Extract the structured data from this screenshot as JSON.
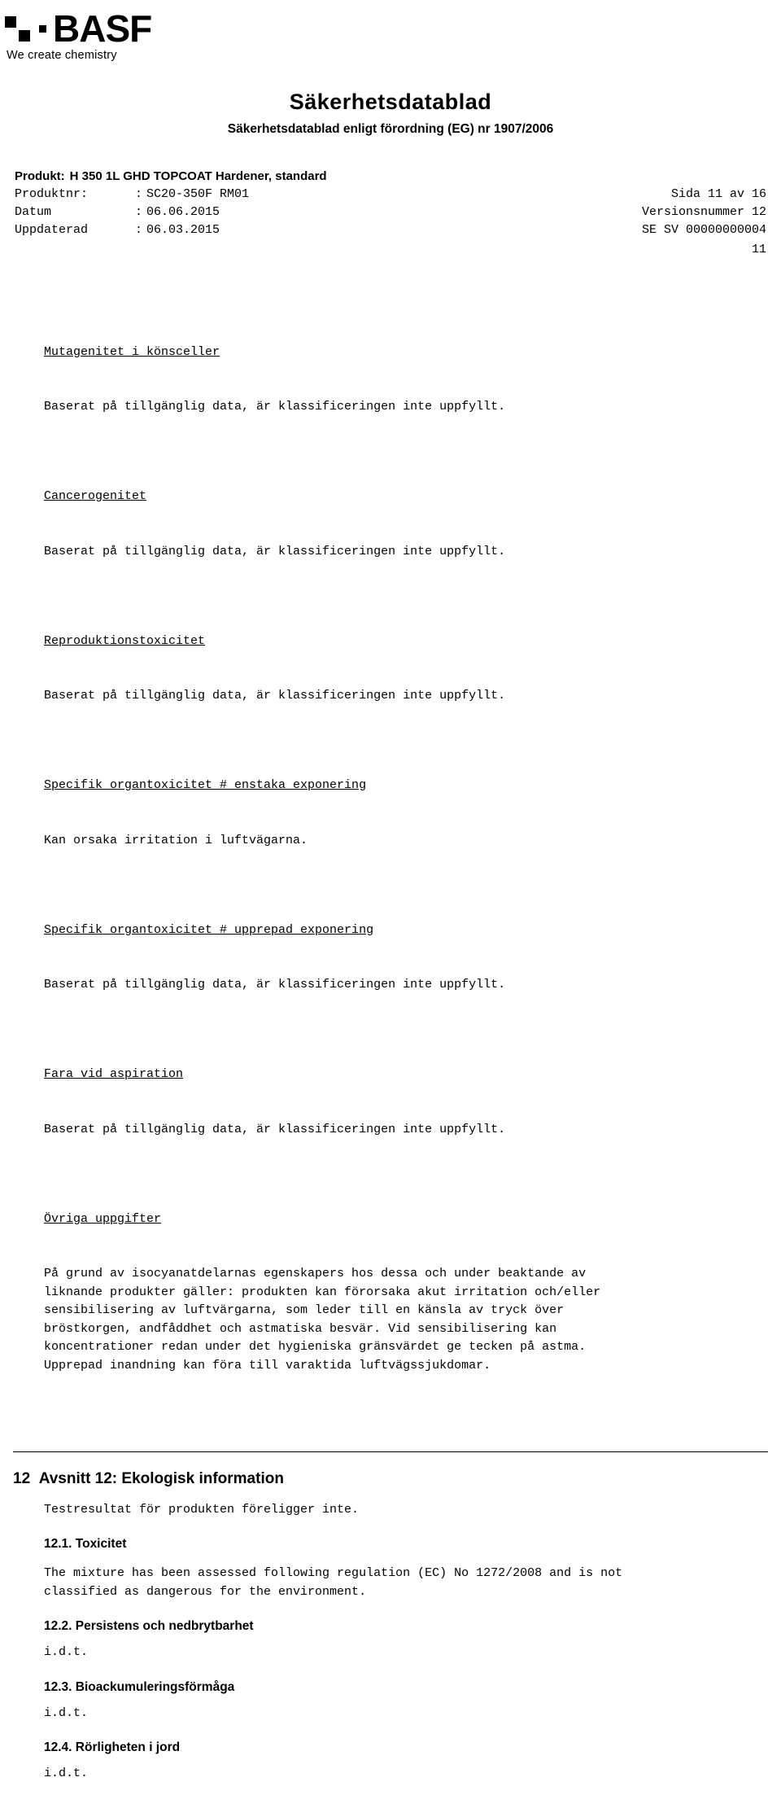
{
  "logo": {
    "brand": "BASF",
    "tagline": "We create chemistry"
  },
  "title": {
    "main": "Säkerhetsdatablad",
    "sub": "Säkerhetsdatablad enligt förordning (EG) nr 1907/2006"
  },
  "meta": {
    "product_label": "Produkt:",
    "product_value": "H 350 1L GHD TOPCOAT Hardener,\n        standard",
    "rows": [
      {
        "key": "Produktnr:",
        "sep": ":",
        "value": "SC20-350F RM01",
        "right": "Sida 11 av 16"
      },
      {
        "key": "Datum",
        "sep": ":",
        "value": "06.06.2015",
        "right": "Versionsnummer 12"
      },
      {
        "key": "Uppdaterad",
        "sep": ":",
        "value": "06.03.2015",
        "right": "SE SV 00000000004"
      }
    ],
    "page_number": "11"
  },
  "content": {
    "blocks": [
      {
        "heading": "Mutagenitet i könsceller",
        "text": "Baserat på tillgänglig data, är klassificeringen inte uppfyllt."
      },
      {
        "heading": "Cancerogenitet",
        "text": "Baserat på tillgänglig data, är klassificeringen inte uppfyllt."
      },
      {
        "heading": "Reproduktionstoxicitet",
        "text": "Baserat på tillgänglig data, är klassificeringen inte uppfyllt."
      },
      {
        "heading": "Specifik organtoxicitet # enstaka exponering",
        "text": "Kan orsaka irritation i luftvägarna."
      },
      {
        "heading": "Specifik organtoxicitet # upprepad exponering",
        "text": "Baserat på tillgänglig data, är klassificeringen inte uppfyllt."
      },
      {
        "heading": "Fara vid aspiration",
        "text": "Baserat på tillgänglig data, är klassificeringen inte uppfyllt."
      },
      {
        "heading": "Övriga uppgifter",
        "text": "På grund av isocyanatdelarnas egenskapers hos dessa och under beaktande av\nliknande produkter gäller: produkten kan förorsaka akut irritation och/eller\nsensibilisering av luftvärgarna, som leder till en känsla av tryck över\nbröstkorgen, andfåddhet och astmatiska besvär. Vid sensibilisering kan\nkoncentrationer redan under det hygieniska gränsvärdet ge tecken på astma.\nUpprepad inandning kan föra till varaktida luftvägssjukdomar."
      }
    ]
  },
  "section12": {
    "number": "12",
    "heading": "Avsnitt 12: Ekologisk information",
    "intro": "Testresultat för produkten föreligger inte.",
    "subsections": [
      {
        "head": "12.1. Toxicitet",
        "text": "The mixture has been assessed following regulation (EC) No 1272/2008 and is not\nclassified as dangerous for the environment."
      },
      {
        "head": "12.2. Persistens och nedbrytbarhet",
        "text": "i.d.t."
      },
      {
        "head": "12.3. Bioackumuleringsförmåga",
        "text": "i.d.t."
      },
      {
        "head": "12.4. Rörligheten i jord",
        "text": "i.d.t."
      }
    ]
  }
}
